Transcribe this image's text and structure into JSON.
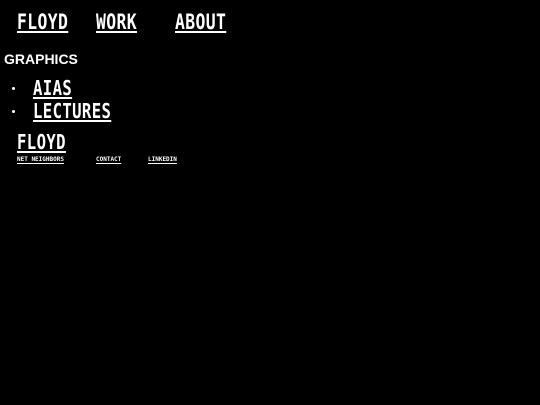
{
  "nav": {
    "home": "FLOYD",
    "work": "WORK",
    "about": "ABOUT"
  },
  "section": {
    "heading": "GRAPHICS",
    "items": [
      {
        "label": "AIAS"
      },
      {
        "label": "LECTURES"
      }
    ]
  },
  "footer": {
    "logo": "FLOYD",
    "links": {
      "net_neighbors": "NET NEIGHBORS",
      "contact": "CONTACT",
      "linkedin": "LINKEDIN"
    }
  },
  "colors": {
    "background": "#000000",
    "text": "#ffffff"
  }
}
